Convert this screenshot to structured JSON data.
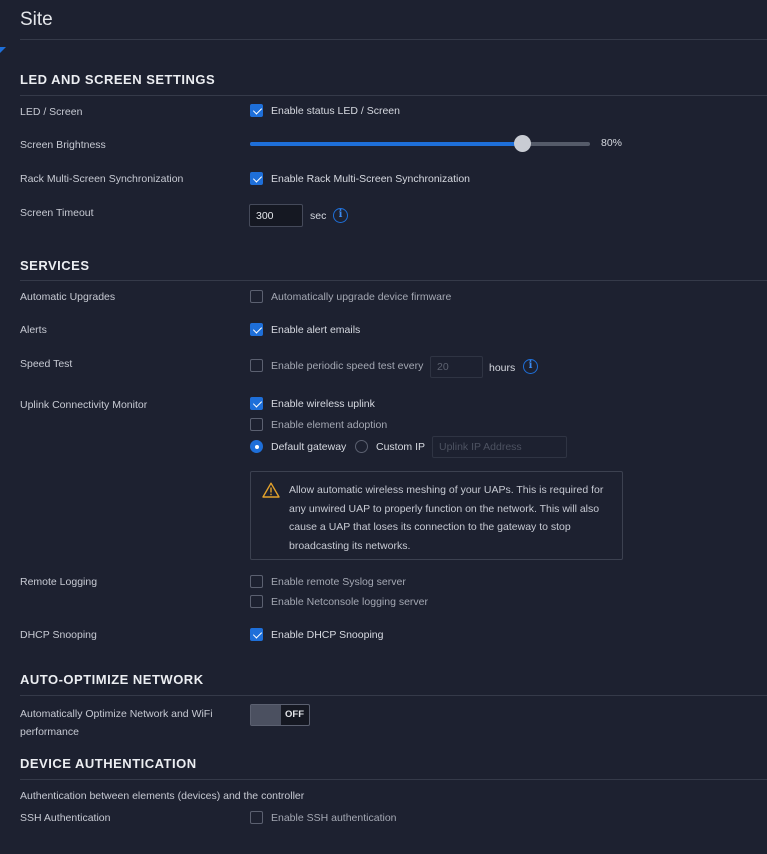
{
  "page": {
    "title": "Site"
  },
  "colors": {
    "accent": "#1e6fd9",
    "background": "#1d2130",
    "warning": "#e3a22b"
  },
  "sections": {
    "led": {
      "title": "LED AND SCREEN SETTINGS",
      "rows": {
        "led_screen": {
          "label": "LED / Screen",
          "option": "Enable status LED / Screen",
          "checked": true
        },
        "brightness": {
          "label": "Screen Brightness",
          "value": 80,
          "value_text": "80%"
        },
        "rack_sync": {
          "label": "Rack Multi-Screen Synchronization",
          "option": "Enable Rack Multi-Screen Synchronization",
          "checked": true
        },
        "timeout": {
          "label": "Screen Timeout",
          "value": "300",
          "unit": "sec",
          "info_icon": "info-icon"
        }
      }
    },
    "services": {
      "title": "SERVICES",
      "rows": {
        "auto_upgrades": {
          "label": "Automatic Upgrades",
          "option": "Automatically upgrade device firmware",
          "checked": false
        },
        "alerts": {
          "label": "Alerts",
          "option": "Enable alert emails",
          "checked": true
        },
        "speed_test": {
          "label": "Speed Test",
          "option": "Enable periodic speed test every",
          "checked": false,
          "interval": "20",
          "unit": "hours",
          "info_icon": "info-icon"
        },
        "uplink": {
          "label": "Uplink Connectivity Monitor",
          "wireless_uplink": {
            "option": "Enable wireless uplink",
            "checked": true
          },
          "element_adoption": {
            "option": "Enable element adoption",
            "checked": false
          },
          "default_gateway": {
            "option": "Default gateway",
            "selected": true
          },
          "custom_ip": {
            "option": "Custom IP",
            "selected": false,
            "placeholder": "Uplink IP Address"
          },
          "warning": {
            "icon": "warning-triangle-icon",
            "text": "Allow automatic wireless meshing of your UAPs. This is required for any unwired UAP to properly function on the network. This will also cause a UAP that loses its connection to the gateway to stop broadcasting its networks."
          }
        },
        "remote_logging": {
          "label": "Remote Logging",
          "syslog": {
            "option": "Enable remote Syslog server",
            "checked": false
          },
          "netconsole": {
            "option": "Enable Netconsole logging server",
            "checked": false
          }
        },
        "dhcp_snooping": {
          "label": "DHCP Snooping",
          "option": "Enable DHCP Snooping",
          "checked": true
        }
      }
    },
    "auto_optimize": {
      "title": "AUTO-OPTIMIZE NETWORK",
      "rows": {
        "optimize": {
          "label_line1": "Automatically Optimize Network and WiFi",
          "label_line2": "performance",
          "toggle_text": "OFF",
          "enabled": false
        }
      }
    },
    "device_auth": {
      "title": "DEVICE AUTHENTICATION",
      "subtitle": "Authentication between elements (devices) and the controller",
      "rows": {
        "ssh": {
          "label": "SSH Authentication",
          "option": "Enable SSH authentication",
          "checked": false
        }
      }
    }
  }
}
